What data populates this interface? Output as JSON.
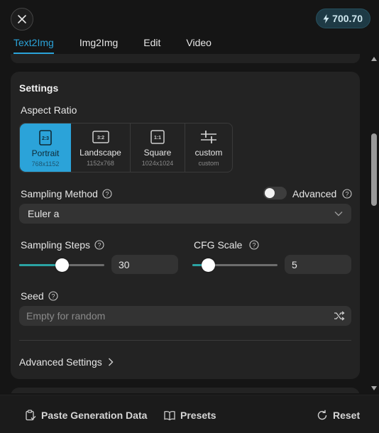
{
  "header": {
    "close_icon": "close-icon",
    "credits": "700.70",
    "credits_icon": "lightning-icon"
  },
  "tabs": [
    {
      "label": "Text2Img",
      "active": true
    },
    {
      "label": "Img2Img",
      "active": false
    },
    {
      "label": "Edit",
      "active": false
    },
    {
      "label": "Video",
      "active": false
    }
  ],
  "settings": {
    "title": "Settings",
    "aspect_ratio_label": "Aspect Ratio",
    "aspect_options": [
      {
        "icon_text": "2:3",
        "name": "Portrait",
        "dims": "768x1152",
        "selected": true
      },
      {
        "icon_text": "3:2",
        "name": "Landscape",
        "dims": "1152x768",
        "selected": false
      },
      {
        "icon_text": "1:1",
        "name": "Square",
        "dims": "1024x1024",
        "selected": false
      },
      {
        "icon_text": "",
        "name": "custom",
        "dims": "custom",
        "selected": false
      }
    ],
    "sampling_method_label": "Sampling Method",
    "advanced_label": "Advanced",
    "advanced_on": false,
    "sampling_method_value": "Euler a",
    "sampling_steps_label": "Sampling Steps",
    "sampling_steps_value": "30",
    "sampling_steps_fraction": 0.5,
    "cfg_scale_label": "CFG Scale",
    "cfg_scale_value": "5",
    "cfg_scale_fraction": 0.19,
    "seed_label": "Seed",
    "seed_placeholder": "Empty for random",
    "advanced_settings_label": "Advanced Settings"
  },
  "footer": {
    "paste_label": "Paste Generation Data",
    "presets_label": "Presets",
    "reset_label": "Reset"
  },
  "colors": {
    "accent": "#2ba3d9",
    "slider_fill": "#2ba3a3",
    "background": "#151515",
    "card": "#232323"
  }
}
